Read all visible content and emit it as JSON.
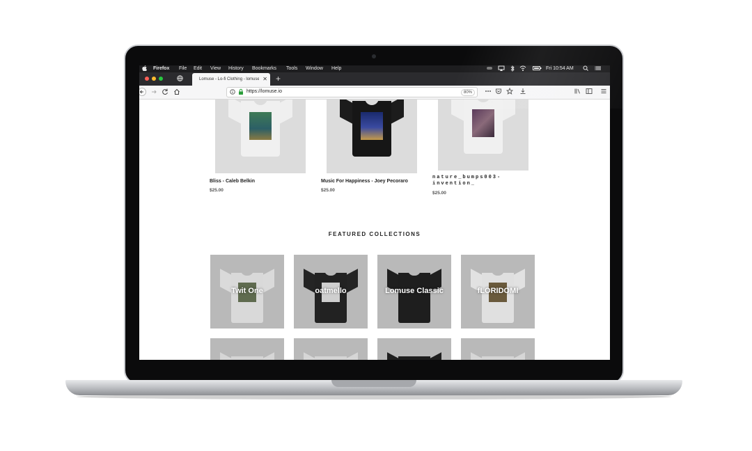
{
  "menubar": {
    "apple": "",
    "app": "Firefox",
    "items": [
      "File",
      "Edit",
      "View",
      "History",
      "Bookmarks",
      "Tools",
      "Window",
      "Help"
    ],
    "clock": "Fri 10:54 AM"
  },
  "tab": {
    "title": "Lomuse - Lo-fi Clothing - lomuse",
    "close": "✕",
    "new_tab": "+"
  },
  "navbar": {
    "url": "https://lomuse.io",
    "zoom": "80%"
  },
  "products": [
    {
      "name": "Bliss - Caleb Belkin",
      "price": "$25.00"
    },
    {
      "name": "Music For Happiness - Joey Pecoraro",
      "price": "$25.00"
    },
    {
      "name_line1": "nature_bumps003-",
      "name_line2": "invention_",
      "price": "$25.00"
    }
  ],
  "featured": {
    "title": "FEATURED COLLECTIONS",
    "collections": [
      {
        "label": "Twit One",
        "shirt": "#d9d9d9",
        "print": "#5f6b4f"
      },
      {
        "label": "oatmello",
        "shirt": "#222222",
        "print": "#cfcfcf"
      },
      {
        "label": "Lomuse Classic",
        "shirt": "#1e1e1e",
        "print": "#1e1e1e"
      },
      {
        "label": "fLORIDOMI",
        "shirt": "#e0e0e0",
        "print": "#6a5a3c"
      }
    ]
  },
  "colors": {
    "traffic_red": "#fd5f57",
    "traffic_yellow": "#febc2e",
    "traffic_green": "#28c840",
    "menubar_bg": "#1d1d1f",
    "tabbar_bg": "#2b2b2e"
  }
}
